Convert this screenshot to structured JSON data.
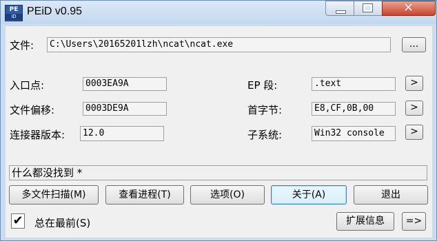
{
  "window": {
    "title": "PEiD v0.95",
    "icon_text": "PE",
    "icon_sub": "iD"
  },
  "file": {
    "label": "文件:",
    "path": "C:\\Users\\20165201lzh\\ncat\\ncat.exe",
    "browse_label": "..."
  },
  "info": {
    "entry_point_label": "入口点:",
    "entry_point_value": "0003EA9A",
    "file_offset_label": "文件偏移:",
    "file_offset_value": "0003DE9A",
    "linker_label": "连接器版本:",
    "linker_value": "12.0",
    "ep_section_label": "EP 段:",
    "ep_section_value": ".text",
    "first_bytes_label": "首字节:",
    "first_bytes_value": "E8,CF,0B,00",
    "subsystem_label": "子系统:",
    "subsystem_value": "Win32 console",
    "arrow_label": ">"
  },
  "status": {
    "text": "什么都没找到  *"
  },
  "buttons": {
    "multi_scan": "多文件扫描(M)",
    "task_viewer": "查看进程(T)",
    "options": "选项(O)",
    "about": "关于(A)",
    "exit": "退出",
    "extensions": "扩展信息",
    "plugins_arrow": "=>"
  },
  "always_on_top": {
    "label": "总在最前(S)",
    "checked": true,
    "check_glyph": "✔"
  }
}
